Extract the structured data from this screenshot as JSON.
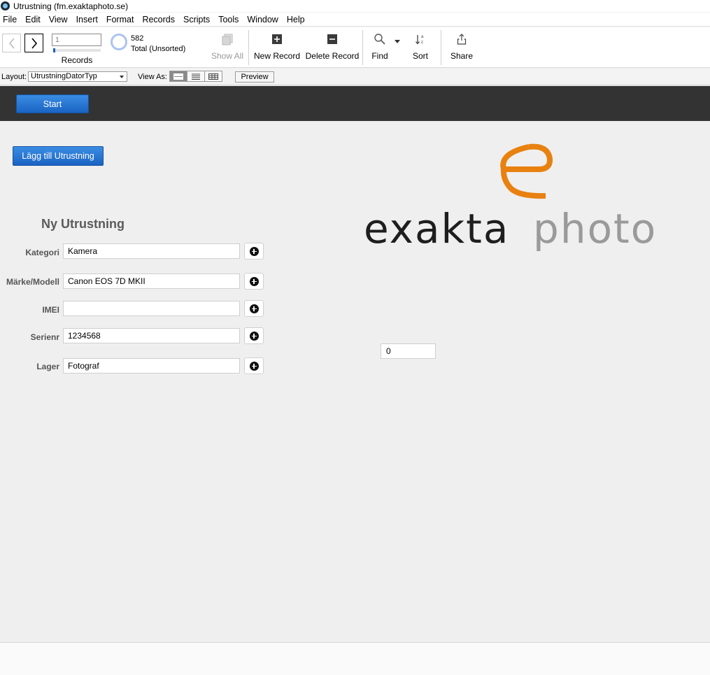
{
  "window": {
    "title": "Utrustning (fm.exaktaphoto.se)"
  },
  "menu": [
    "File",
    "Edit",
    "View",
    "Insert",
    "Format",
    "Records",
    "Scripts",
    "Tools",
    "Window",
    "Help"
  ],
  "toolbar": {
    "record_number": "1",
    "records_label": "Records",
    "total_count": "582",
    "total_status": "Total (Unsorted)",
    "show_all": "Show All",
    "new_record": "New Record",
    "delete_record": "Delete Record",
    "find": "Find",
    "sort": "Sort",
    "share": "Share"
  },
  "layout_bar": {
    "layout_label": "Layout:",
    "layout_value": "UtrustningDatorTyp",
    "view_as_label": "View As:",
    "preview": "Preview"
  },
  "header": {
    "start_button": "Start"
  },
  "form": {
    "add_button": "Lägg till Utrustning",
    "title": "Ny Utrustning",
    "fields": [
      {
        "label": "Kategori",
        "value": "Kamera"
      },
      {
        "label": "Märke/Modell",
        "value": "Canon EOS 7D MKII"
      },
      {
        "label": "IMEI",
        "value": ""
      },
      {
        "label": "Serienr",
        "value": "1234568"
      },
      {
        "label": "Lager",
        "value": "Fotograf"
      }
    ],
    "counter_value": "0"
  },
  "logo": {
    "text_dark": "exakta",
    "text_light": "photo",
    "accent_color": "#e8810f"
  }
}
